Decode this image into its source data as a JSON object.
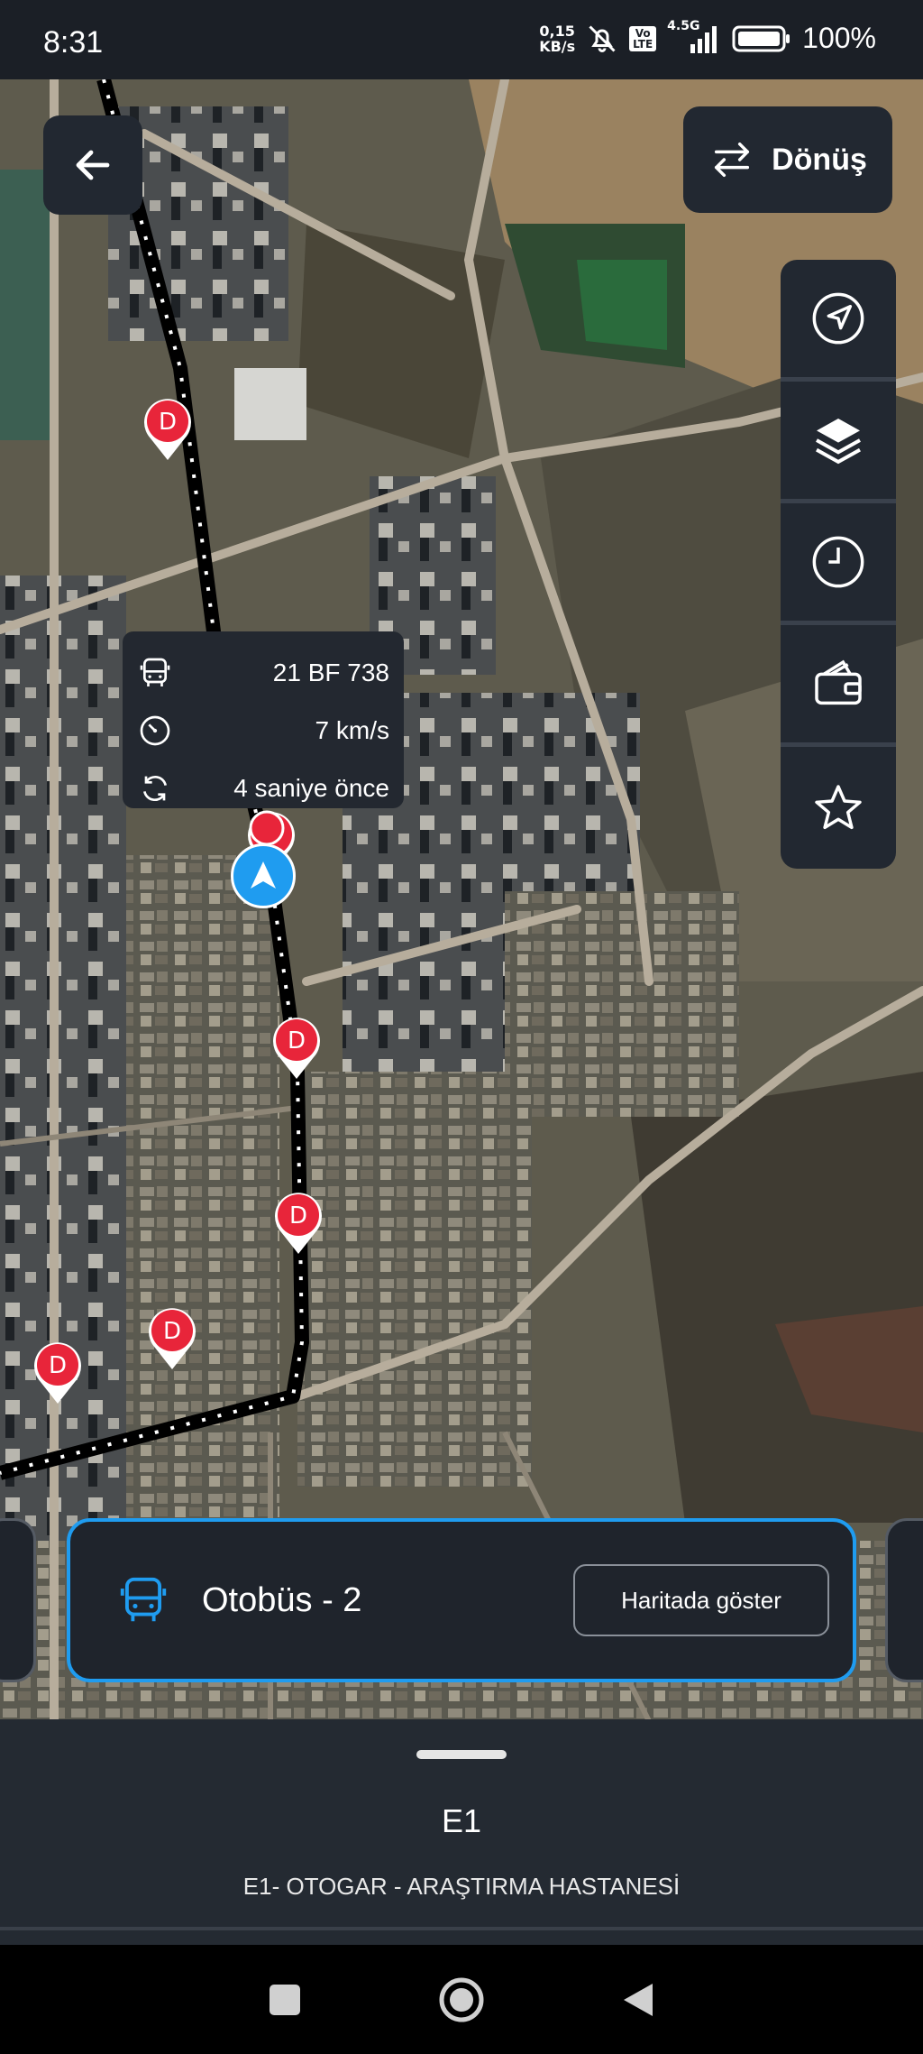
{
  "status_bar": {
    "time": "8:31",
    "net_speed_value": "0,15",
    "net_speed_unit": "KB/s",
    "network": "4.5G",
    "volte": "Vo LTE",
    "battery": "100%"
  },
  "map": {
    "back_icon": "arrow-left-icon",
    "return_button_label": "Dönüş",
    "tools": [
      "locate-icon",
      "layers-icon",
      "clock-icon",
      "wallet-icon",
      "star-icon"
    ],
    "stop_marker_letter": "D",
    "vehicle_info": {
      "plate": "21 BF 738",
      "speed": "7 km/s",
      "updated": "4 saniye önce"
    }
  },
  "vehicle_card": {
    "label": "Otobüs - 2",
    "button": "Haritada göster"
  },
  "sheet": {
    "route_code": "E1",
    "route_name": "E1- OTOGAR - ARAŞTIRMA HASTANESİ"
  },
  "colors": {
    "accent": "#1f9cf0",
    "stop_marker": "#e8253a",
    "panel": "#222831"
  }
}
